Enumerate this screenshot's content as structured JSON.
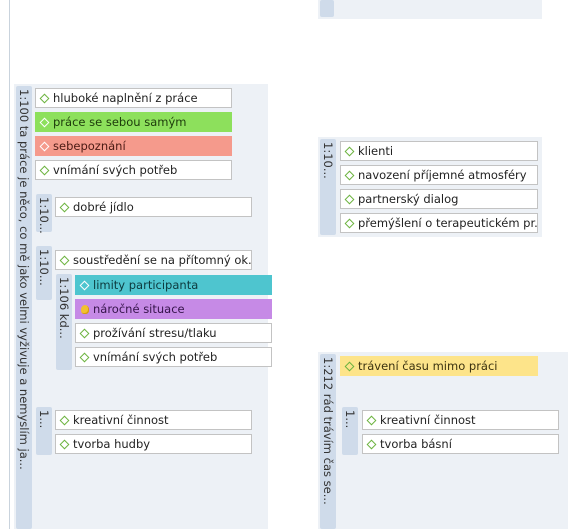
{
  "left_panel": {
    "main_label": "1:100 ta práce je něco, co mě jako velmi vyživuje a nemyslím ja...",
    "top_codes": [
      {
        "label": "hluboké naplnění z práce",
        "style": "plain"
      },
      {
        "label": "práce se sebou samým",
        "style": "green"
      },
      {
        "label": "sebepoznání",
        "style": "red"
      },
      {
        "label": "vnímání svých potřeb",
        "style": "plain"
      }
    ],
    "sub1": {
      "label": "1:10...",
      "codes": [
        {
          "label": "dobré jídlo"
        }
      ]
    },
    "sub2": {
      "label": "1:10...",
      "top_code": "soustředění se na přítomný ok...",
      "sub": {
        "label": "1:106 kd...",
        "codes": [
          {
            "label": "limity participanta",
            "style": "teal"
          },
          {
            "label": "náročné situace",
            "style": "purple"
          },
          {
            "label": "prožívání stresu/tlaku",
            "style": "plain"
          },
          {
            "label": "vnímání svých potřeb",
            "style": "plain"
          }
        ]
      }
    },
    "sub3": {
      "label": "1...",
      "codes": [
        {
          "label": "kreativní činnost"
        },
        {
          "label": "tvorba hudby"
        }
      ]
    }
  },
  "right_panel": {
    "group1": {
      "label": "1:10...",
      "codes": [
        {
          "label": "klienti"
        },
        {
          "label": "navození příjemné atmosféry"
        },
        {
          "label": "partnerský dialog"
        },
        {
          "label": "přemýšlení o terapeutickém pr..."
        }
      ]
    },
    "group2": {
      "label": "1:212 rád trávím čas se...",
      "top_code": "trávení času mimo práci",
      "sub": {
        "label": "1...",
        "codes": [
          {
            "label": "kreativní činnost"
          },
          {
            "label": "tvorba básní"
          }
        ]
      }
    }
  }
}
